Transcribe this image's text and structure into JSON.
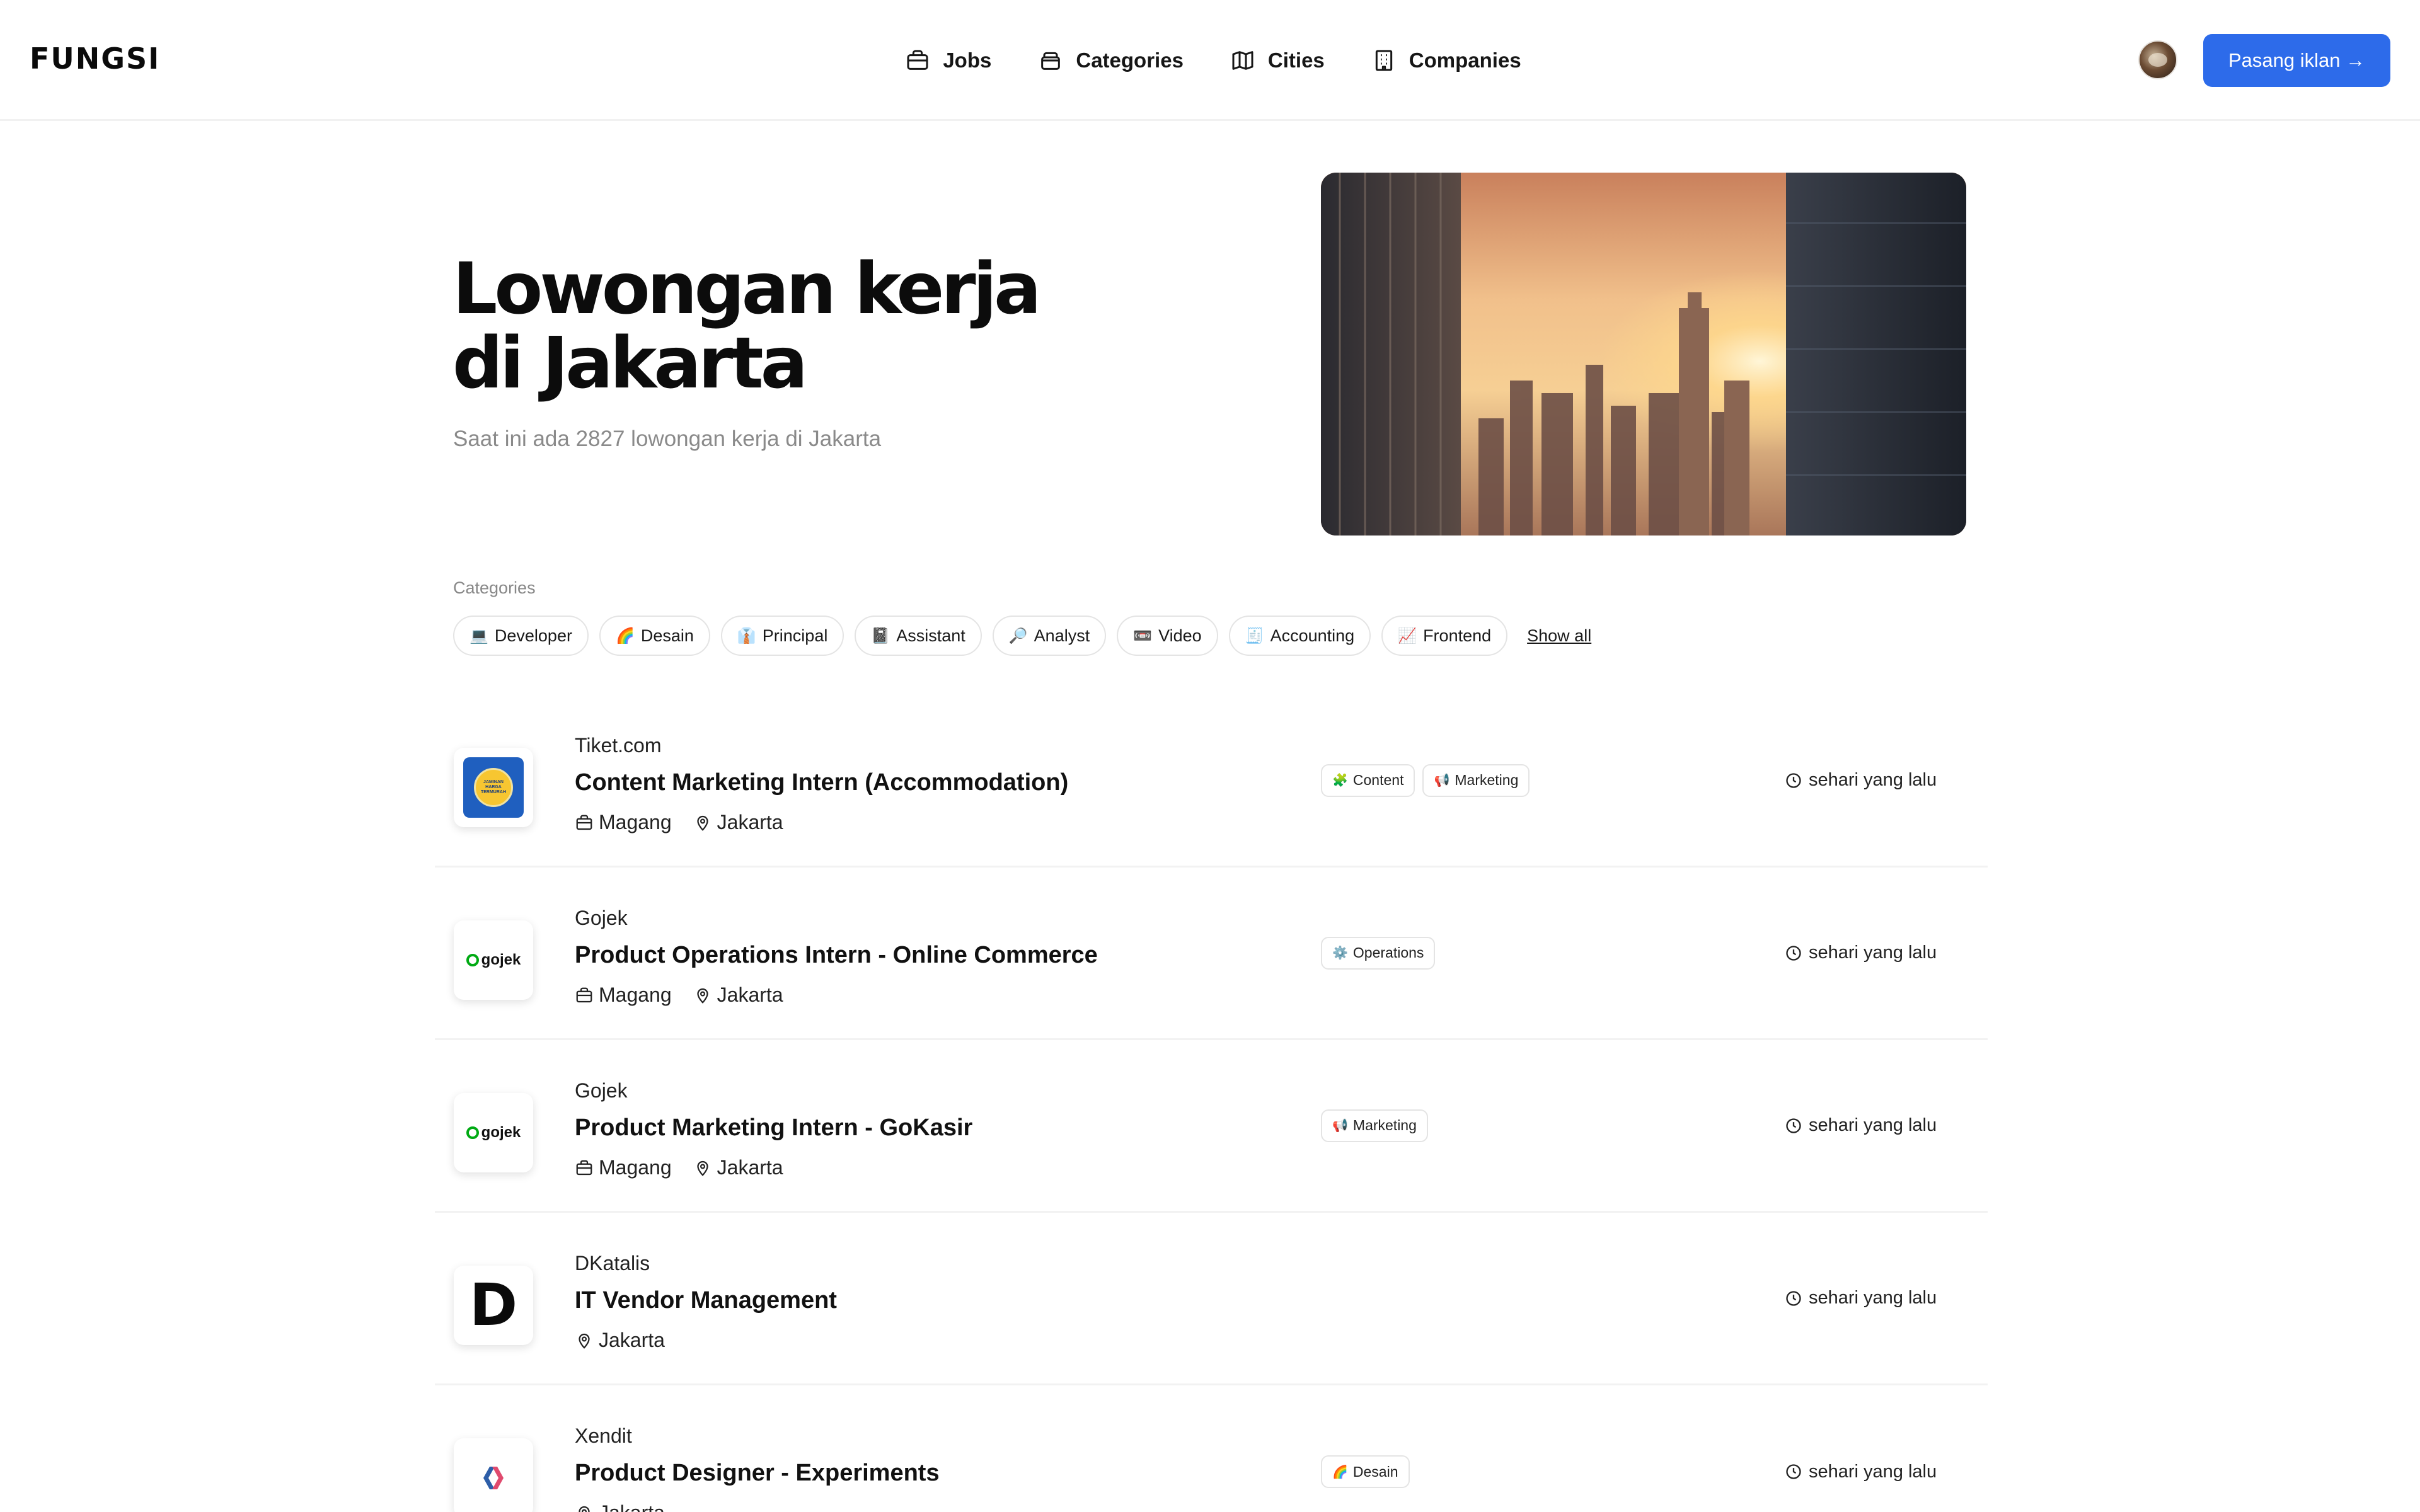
{
  "header": {
    "logo": "FUNGSI",
    "nav": [
      {
        "label": "Jobs",
        "icon": "briefcase-icon"
      },
      {
        "label": "Categories",
        "icon": "folder-icon"
      },
      {
        "label": "Cities",
        "icon": "map-icon"
      },
      {
        "label": "Companies",
        "icon": "building-icon"
      }
    ],
    "cta_label": "Pasang iklan →",
    "accent_color": "#2d6bea"
  },
  "hero": {
    "title_line1": "Lowongan kerja",
    "title_line2": "di Jakarta",
    "subtitle": "Saat ini ada 2827 lowongan kerja di Jakarta"
  },
  "categories": {
    "label": "Categories",
    "items": [
      {
        "emoji": "💻",
        "label": "Developer"
      },
      {
        "emoji": "🌈",
        "label": "Desain"
      },
      {
        "emoji": "👔",
        "label": "Principal"
      },
      {
        "emoji": "📓",
        "label": "Assistant"
      },
      {
        "emoji": "🔎",
        "label": "Analyst"
      },
      {
        "emoji": "📼",
        "label": "Video"
      },
      {
        "emoji": "🧾",
        "label": "Accounting"
      },
      {
        "emoji": "📈",
        "label": "Frontend"
      }
    ],
    "show_all": "Show all"
  },
  "jobs": [
    {
      "company": "Tiket.com",
      "title": "Content Marketing Intern (Accommodation)",
      "type": "Magang",
      "location": "Jakarta",
      "tags": [
        {
          "emoji": "🧩",
          "label": "Content"
        },
        {
          "emoji": "📢",
          "label": "Marketing"
        }
      ],
      "time": "sehari yang lalu",
      "logo_text": "JAMINAN HARGA TERMURAH"
    },
    {
      "company": "Gojek",
      "title": "Product Operations Intern - Online Commerce",
      "type": "Magang",
      "location": "Jakarta",
      "tags": [
        {
          "emoji": "⚙️",
          "label": "Operations"
        }
      ],
      "time": "sehari yang lalu",
      "logo_text": "gojek"
    },
    {
      "company": "Gojek",
      "title": "Product Marketing Intern - GoKasir",
      "type": "Magang",
      "location": "Jakarta",
      "tags": [
        {
          "emoji": "📢",
          "label": "Marketing"
        }
      ],
      "time": "sehari yang lalu",
      "logo_text": "gojek"
    },
    {
      "company": "DKatalis",
      "title": "IT Vendor Management",
      "type": "",
      "location": "Jakarta",
      "tags": [],
      "time": "sehari yang lalu",
      "logo_text": "D"
    },
    {
      "company": "Xendit",
      "title": "Product Designer - Experiments",
      "type": "",
      "location": "Jakarta",
      "tags": [
        {
          "emoji": "🌈",
          "label": "Desain"
        }
      ],
      "time": "sehari yang lalu",
      "logo_text": ""
    }
  ]
}
